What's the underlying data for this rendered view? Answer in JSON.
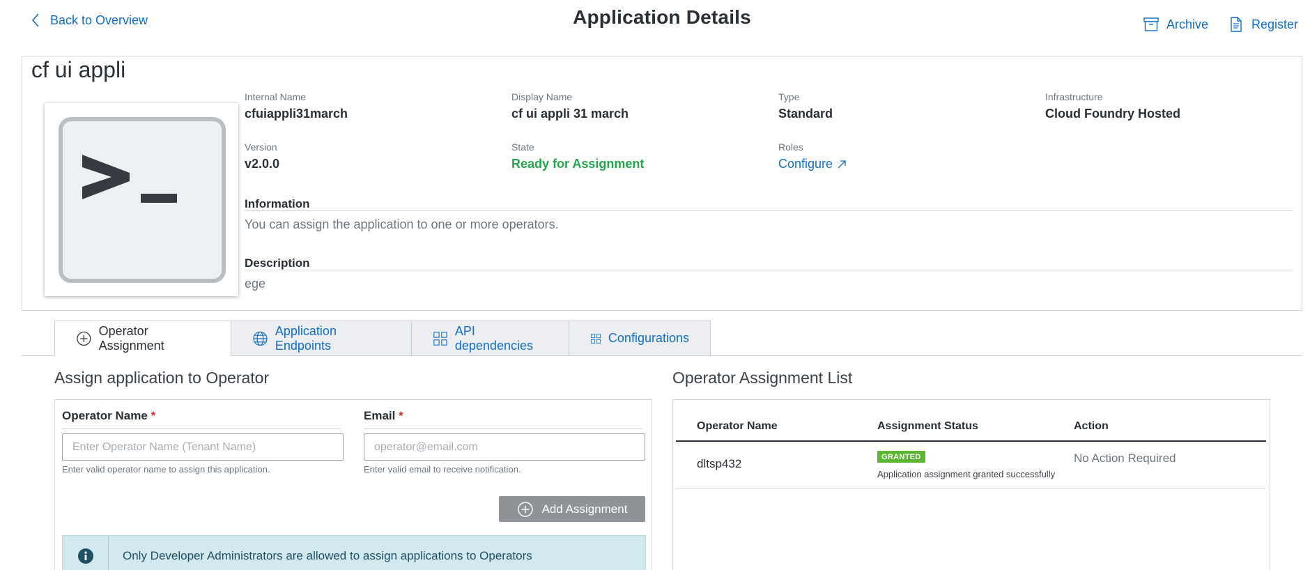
{
  "header": {
    "back_label": "Back to Overview",
    "title": "Application Details",
    "archive_label": "Archive",
    "register_label": "Register"
  },
  "app": {
    "name": "cf ui appli",
    "icon": "terminal-icon",
    "fields": {
      "internal_name": {
        "label": "Internal Name",
        "value": "cfuiappli31march"
      },
      "display_name": {
        "label": "Display Name",
        "value": "cf ui appli 31 march"
      },
      "type": {
        "label": "Type",
        "value": "Standard"
      },
      "infrastructure": {
        "label": "Infrastructure",
        "value": "Cloud Foundry Hosted"
      },
      "version": {
        "label": "Version",
        "value": "v2.0.0"
      },
      "state": {
        "label": "State",
        "value": "Ready for Assignment"
      },
      "roles": {
        "label": "Roles",
        "value": "Configure"
      }
    },
    "information": {
      "heading": "Information",
      "text": "You can assign the application to one or more operators."
    },
    "description": {
      "heading": "Description",
      "text": "ege"
    }
  },
  "tabs": [
    {
      "label": "Operator Assignment",
      "icon": "plus-circle-icon",
      "active": true
    },
    {
      "label": "Application Endpoints",
      "icon": "globe-icon",
      "active": false
    },
    {
      "label": "API dependencies",
      "icon": "grid-icon",
      "active": false
    },
    {
      "label": "Configurations",
      "icon": "grid-icon",
      "active": false
    }
  ],
  "assign_form": {
    "title": "Assign application to Operator",
    "operator_label": "Operator Name",
    "operator_placeholder": "Enter Operator Name (Tenant Name)",
    "operator_hint": "Enter valid operator name to assign this application.",
    "email_label": "Email",
    "email_placeholder": "operator@email.com",
    "email_hint": "Enter valid email to receive notification.",
    "required_marker": "*",
    "add_button": "Add Assignment",
    "info_message": "Only Developer Administrators are allowed to assign applications to Operators"
  },
  "assignment_list": {
    "title": "Operator Assignment List",
    "columns": [
      "Operator Name",
      "Assignment Status",
      "Action"
    ],
    "rows": [
      {
        "operator": "dltsp432",
        "status_badge": "GRANTED",
        "status_message": "Application assignment granted successfully",
        "action": "No Action Required"
      }
    ]
  },
  "colors": {
    "accent": "#0f6ec8",
    "state_ready": "#22a74a",
    "granted_badge": "#5cb531",
    "info_banner_bg": "#d3e9f0",
    "disabled_button": "#8f9398"
  }
}
